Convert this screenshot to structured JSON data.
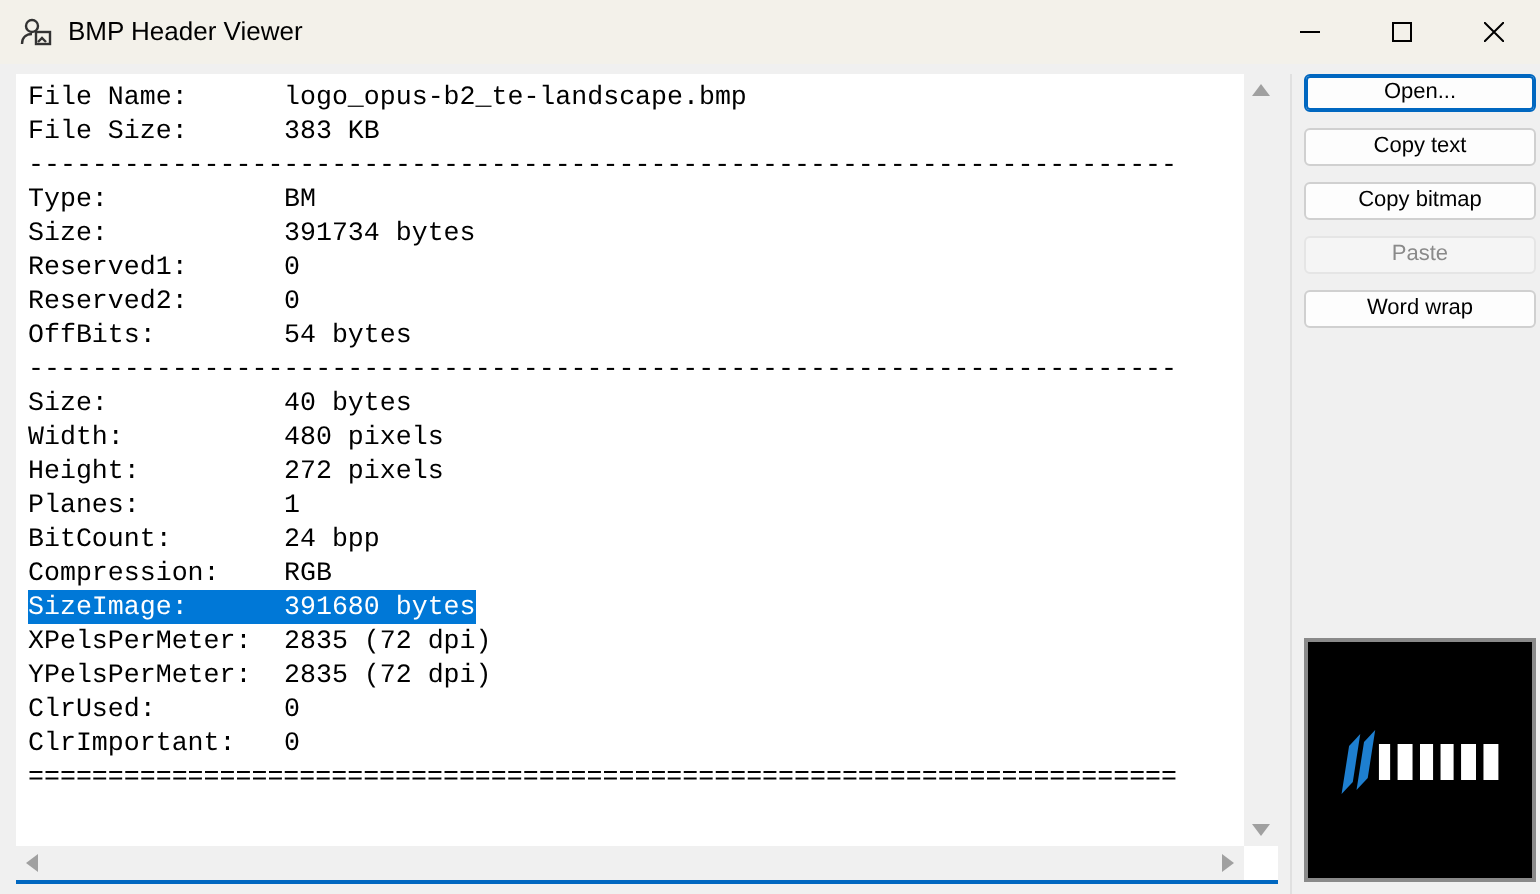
{
  "window": {
    "title": "BMP Header Viewer"
  },
  "lines": [
    {
      "kind": "field",
      "label": "File Name:",
      "value": "logo_opus-b2_te-landscape.bmp",
      "selected": false
    },
    {
      "kind": "field",
      "label": "File Size:",
      "value": "383 KB",
      "selected": false
    },
    {
      "kind": "rule",
      "text": "------------------------------------------------------------------------"
    },
    {
      "kind": "field",
      "label": "Type:",
      "value": "BM",
      "selected": false
    },
    {
      "kind": "field",
      "label": "Size:",
      "value": "391734 bytes",
      "selected": false
    },
    {
      "kind": "field",
      "label": "Reserved1:",
      "value": "0",
      "selected": false
    },
    {
      "kind": "field",
      "label": "Reserved2:",
      "value": "0",
      "selected": false
    },
    {
      "kind": "field",
      "label": "OffBits:",
      "value": "54 bytes",
      "selected": false
    },
    {
      "kind": "rule",
      "text": "------------------------------------------------------------------------"
    },
    {
      "kind": "field",
      "label": "Size:",
      "value": "40 bytes",
      "selected": false
    },
    {
      "kind": "field",
      "label": "Width:",
      "value": "480 pixels",
      "selected": false
    },
    {
      "kind": "field",
      "label": "Height:",
      "value": "272 pixels",
      "selected": false
    },
    {
      "kind": "field",
      "label": "Planes:",
      "value": "1",
      "selected": false
    },
    {
      "kind": "field",
      "label": "BitCount:",
      "value": "24 bpp",
      "selected": false
    },
    {
      "kind": "field",
      "label": "Compression:",
      "value": "RGB",
      "selected": false
    },
    {
      "kind": "field",
      "label": "SizeImage:",
      "value": "391680 bytes",
      "selected": true
    },
    {
      "kind": "field",
      "label": "XPelsPerMeter:",
      "value": "2835 (72 dpi)",
      "selected": false
    },
    {
      "kind": "field",
      "label": "YPelsPerMeter:",
      "value": "2835 (72 dpi)",
      "selected": false
    },
    {
      "kind": "field",
      "label": "ClrUsed:",
      "value": "0",
      "selected": false
    },
    {
      "kind": "field",
      "label": "ClrImportant:",
      "value": "0",
      "selected": false
    },
    {
      "kind": "rule",
      "text": "========================================================================"
    }
  ],
  "buttons": [
    {
      "label": "Open...",
      "focused": true,
      "disabled": false
    },
    {
      "label": "Copy text",
      "focused": false,
      "disabled": false
    },
    {
      "label": "Copy bitmap",
      "focused": false,
      "disabled": false
    },
    {
      "label": "Paste",
      "focused": false,
      "disabled": true
    },
    {
      "label": "Word wrap",
      "focused": false,
      "disabled": false
    }
  ]
}
